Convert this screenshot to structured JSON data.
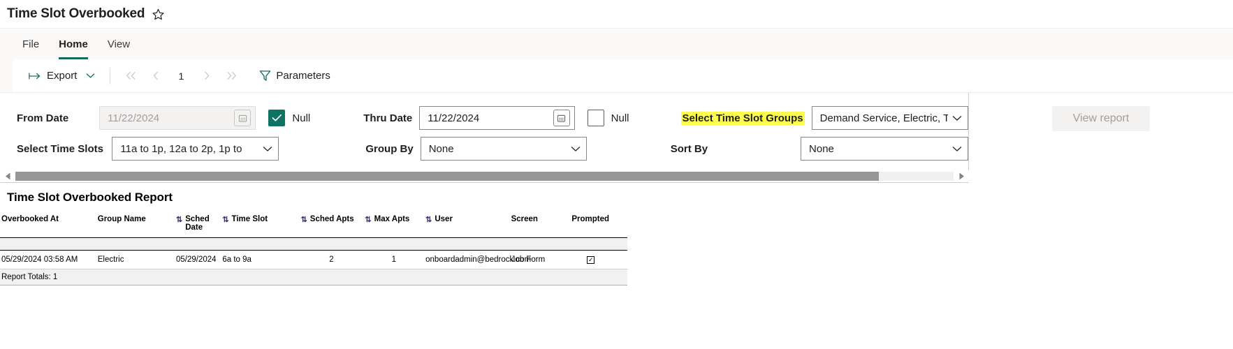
{
  "window": {
    "title": "Time Slot Overbooked",
    "favorite_icon": "star-outline-icon"
  },
  "ribbon": {
    "tabs": [
      {
        "label": "File",
        "active": false
      },
      {
        "label": "Home",
        "active": true
      },
      {
        "label": "View",
        "active": false
      }
    ]
  },
  "toolbar": {
    "export_label": "Export",
    "export_icon": "export-arrow-icon",
    "export_chevron_icon": "chevron-down-icon",
    "pager": {
      "first_icon": "double-chevron-left-icon",
      "prev_icon": "chevron-left-icon",
      "page_number": "1",
      "next_icon": "chevron-right-icon",
      "last_icon": "double-chevron-right-icon"
    },
    "parameters_label": "Parameters",
    "parameters_icon": "funnel-icon"
  },
  "parameters": {
    "from_date": {
      "label": "From Date",
      "value": "11/22/2024",
      "disabled": true,
      "calendar_icon": "calendar-icon",
      "null_label": "Null",
      "null_checked": true
    },
    "thru_date": {
      "label": "Thru Date",
      "value": "11/22/2024",
      "disabled": false,
      "calendar_icon": "calendar-icon",
      "null_label": "Null",
      "null_checked": false
    },
    "time_slot_groups": {
      "label": "Select Time Slot Groups",
      "highlighted": true,
      "highlight_color": "#ffff4d",
      "value": "Demand Service, Electric, T",
      "chevron_icon": "chevron-down-icon"
    },
    "time_slots": {
      "label": "Select Time Slots",
      "value": "11a to 1p, 12a to 2p, 1p to",
      "chevron_icon": "chevron-down-icon"
    },
    "group_by": {
      "label": "Group By",
      "value": "None",
      "chevron_icon": "chevron-down-icon"
    },
    "sort_by": {
      "label": "Sort By",
      "value": "None",
      "chevron_icon": "chevron-down-icon"
    },
    "view_report_label": "View report",
    "view_report_disabled": true
  },
  "scrollbar": {
    "left_arrow_icon": "triangle-left-icon",
    "right_arrow_icon": "triangle-right-icon"
  },
  "report": {
    "title": "Time Slot Overbooked Report",
    "columns": [
      {
        "label": "Overbooked At",
        "sortable": false
      },
      {
        "label": "Group Name",
        "sortable": false
      },
      {
        "label": "Sched Date",
        "sortable": true
      },
      {
        "label": "Time Slot",
        "sortable": true
      },
      {
        "label": "Sched Apts",
        "sortable": true
      },
      {
        "label": "Max Apts",
        "sortable": true
      },
      {
        "label": "User",
        "sortable": true
      },
      {
        "label": "Screen",
        "sortable": false
      },
      {
        "label": "Prompted",
        "sortable": false
      }
    ],
    "sort_icon": "sort-updown-icon",
    "rows": [
      {
        "overbooked_at": "05/29/2024 03:58 AM",
        "group_name": "Electric",
        "sched_date": "05/29/2024",
        "time_slot": "6a to 9a",
        "sched_apts": "2",
        "max_apts": "1",
        "user": "onboardadmin@bedrock.com",
        "screen": "Job Form",
        "prompted": "checked",
        "prompted_icon": "checkbox-checked-icon"
      }
    ],
    "totals_label": "Report Totals: 1"
  }
}
